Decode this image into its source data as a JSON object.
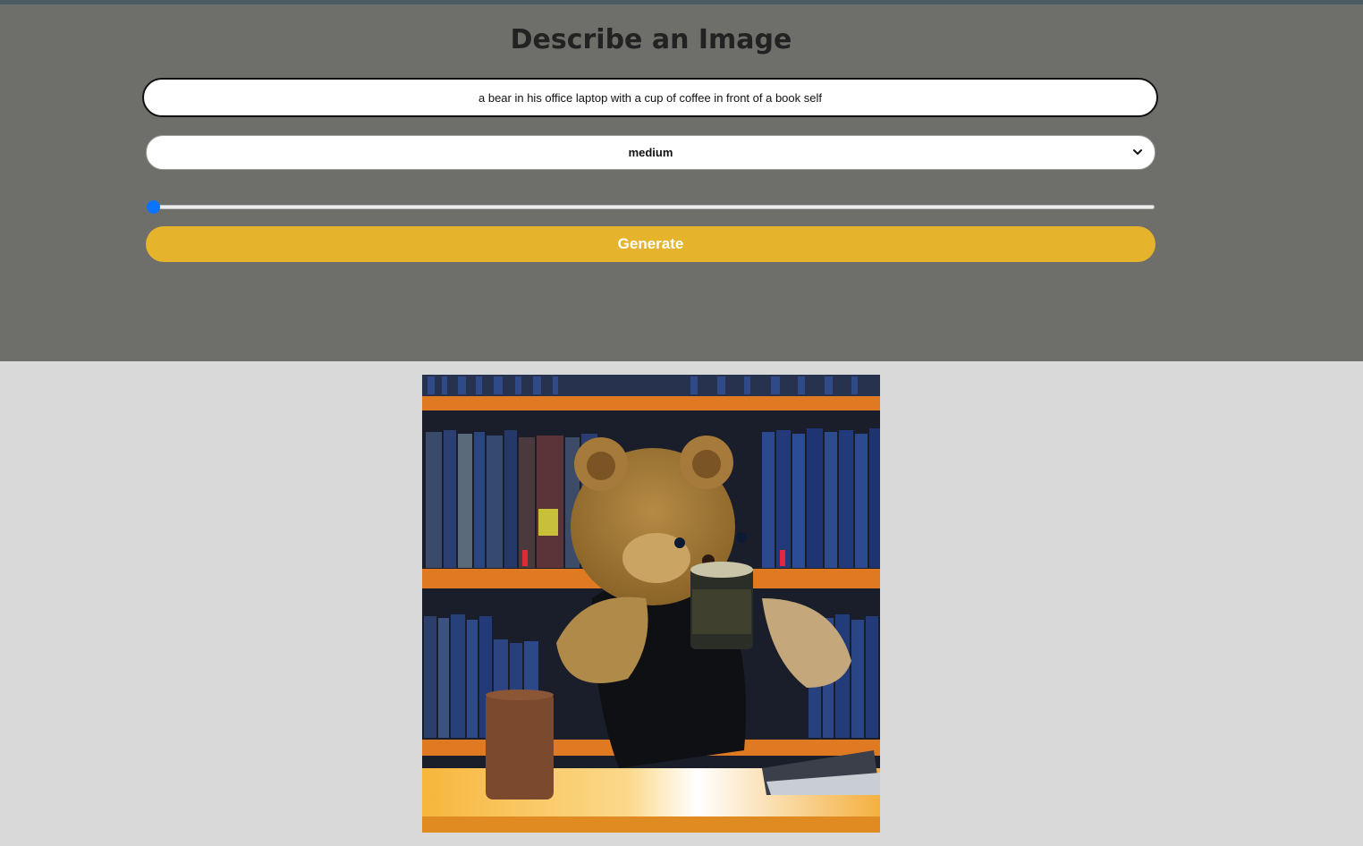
{
  "page": {
    "title": "Describe an Image"
  },
  "form": {
    "prompt_value": "a bear in his office laptop with a cup of coffee in front of a book self",
    "size_selected": "medium",
    "slider_value": 0,
    "generate_label": "Generate"
  },
  "colors": {
    "header_bg": "#6e6f6a",
    "page_bg": "#d9d9d9",
    "accent": "#e6b42c",
    "slider_accent": "#0a74ff"
  },
  "result": {
    "image_alt": "teddy bear holding a cup of coffee at a desk in front of a bookshelf"
  }
}
